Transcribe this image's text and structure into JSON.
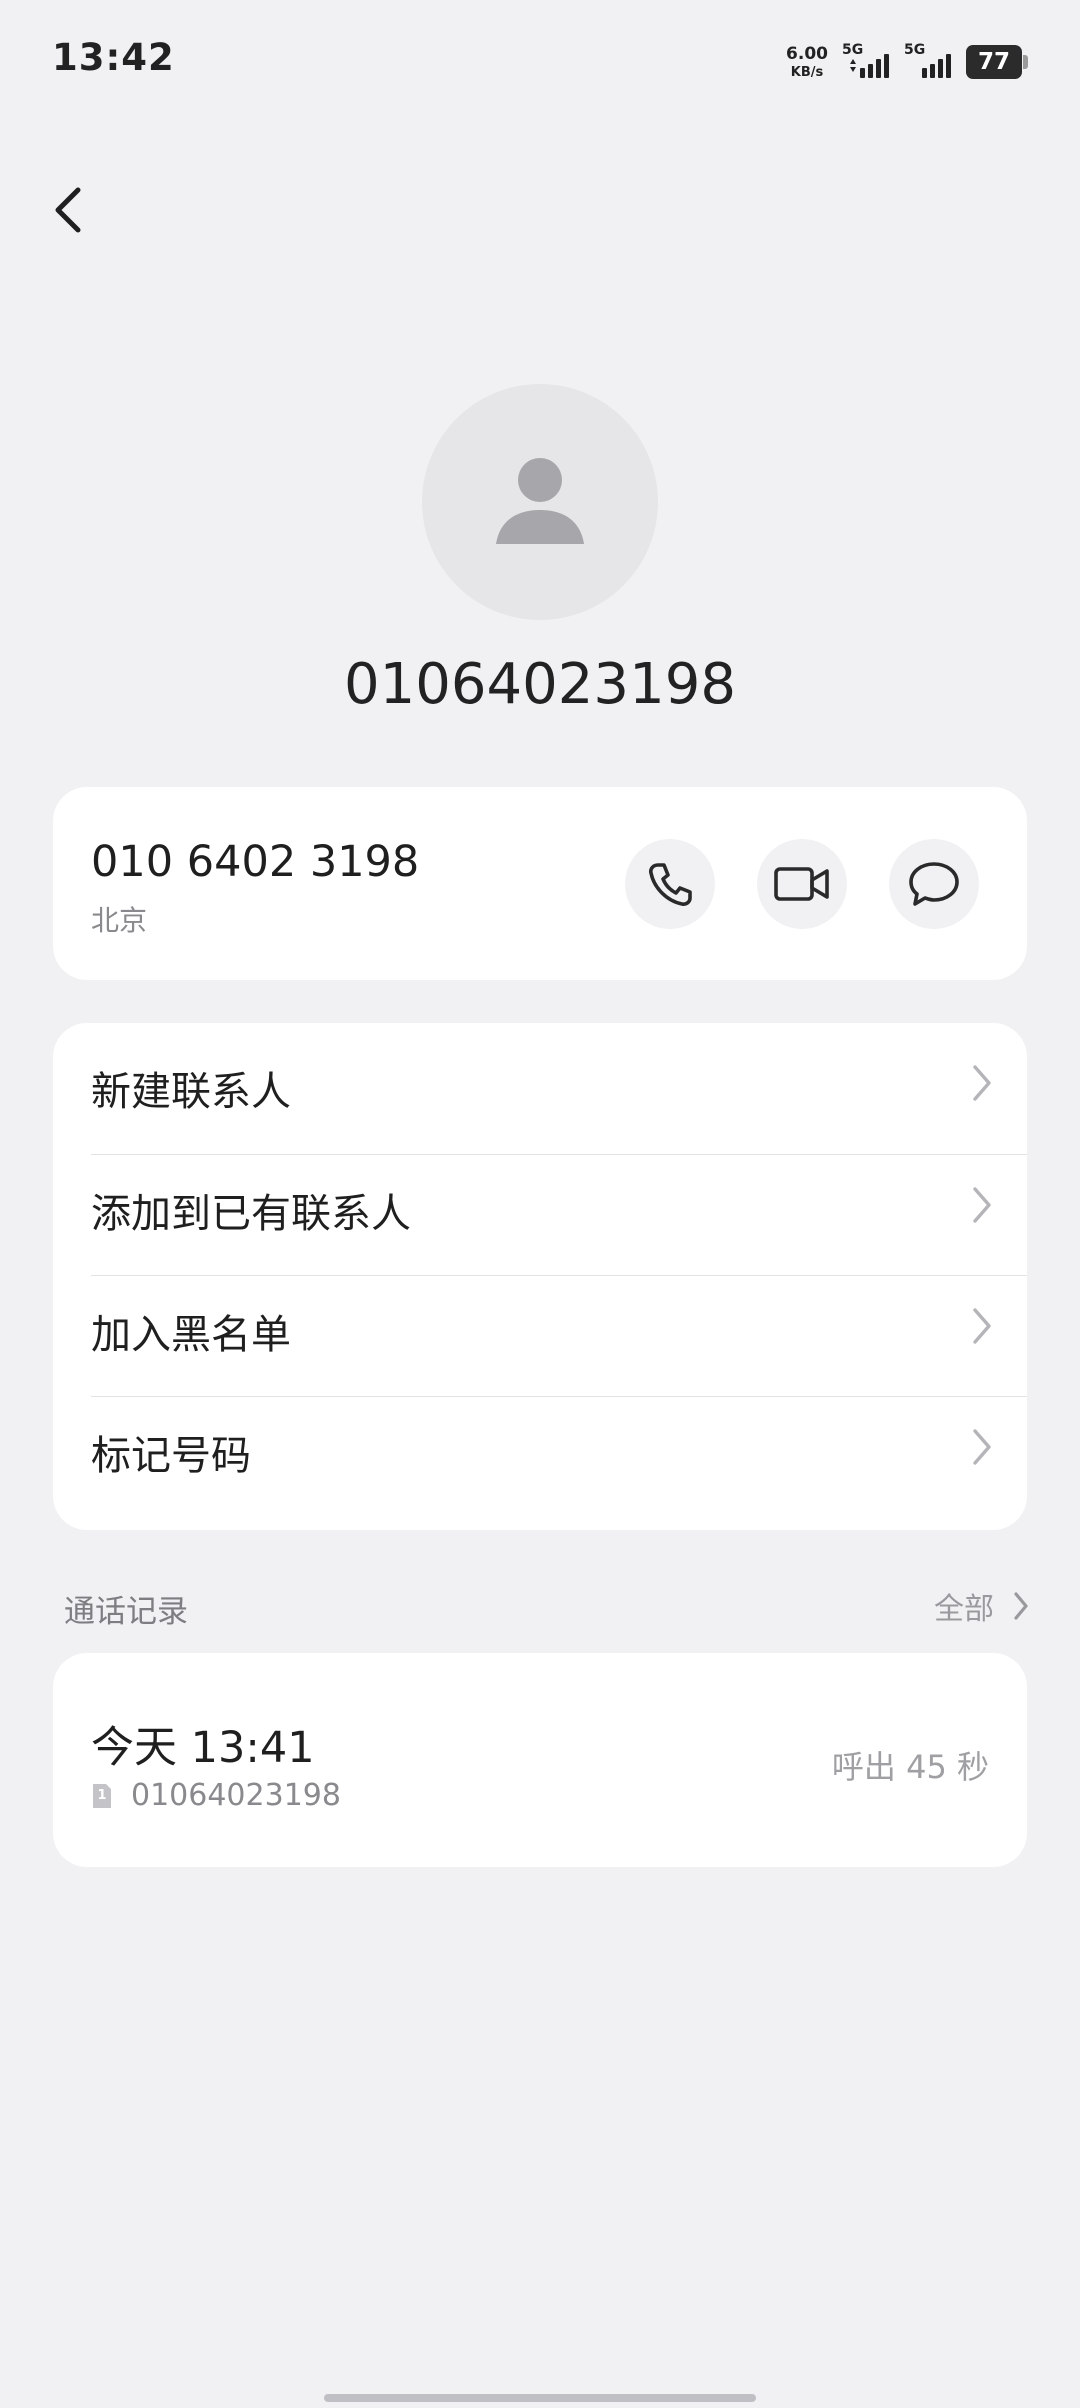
{
  "status_bar": {
    "time": "13:42",
    "net_speed_value": "6.00",
    "net_speed_unit": "KB/s",
    "signal_1_label": "5G",
    "signal_2_label": "5G",
    "battery_level": "77"
  },
  "contact": {
    "title_number": "01064023198",
    "formatted_number": "010 6402 3198",
    "location": "北京"
  },
  "actions": {
    "call_icon": "phone-icon",
    "video_icon": "video-camera-icon",
    "message_icon": "chat-bubble-icon"
  },
  "menu": {
    "items": [
      {
        "label": "新建联系人"
      },
      {
        "label": "添加到已有联系人"
      },
      {
        "label": "加入黑名单"
      },
      {
        "label": "标记号码"
      }
    ]
  },
  "call_log": {
    "section_title": "通话记录",
    "view_all_label": "全部",
    "entries": [
      {
        "time": "今天 13:41",
        "sim": "1",
        "number": "01064023198",
        "detail": "呼出 45 秒"
      }
    ]
  },
  "colors": {
    "background": "#f1f1f3",
    "card": "#ffffff",
    "text_primary": "#1f1f1f",
    "text_secondary": "#8a8a8e",
    "avatar_bg": "#e6e6e8",
    "avatar_fg": "#a7a7ab"
  }
}
